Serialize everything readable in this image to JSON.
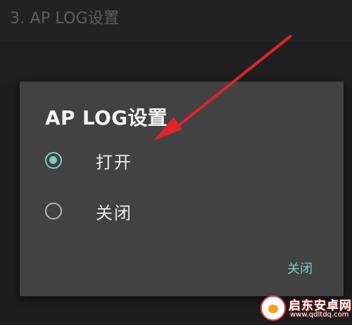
{
  "background": {
    "header_title": "3. AP LOG设置"
  },
  "dialog": {
    "title": "AP LOG设置",
    "options": [
      {
        "label": "打开",
        "selected": true
      },
      {
        "label": "关闭",
        "selected": false
      }
    ],
    "button_label": "关闭"
  },
  "watermark": {
    "name": "启东安卓网",
    "url": "www.qdltdq.com"
  },
  "colors": {
    "accent": "#7fcbc4",
    "dialog_bg": "#424242",
    "annotation_arrow": "#e0242b"
  },
  "annotation": {
    "type": "arrow",
    "target": "dialog-title"
  }
}
